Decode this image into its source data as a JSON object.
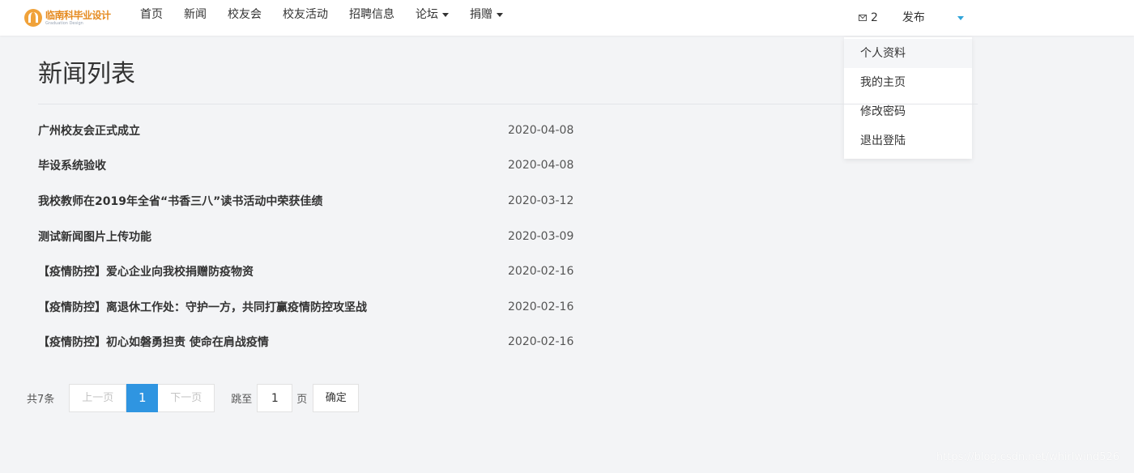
{
  "header": {
    "logo_text": "临南科毕业设计",
    "logo_sub": "Graduation Design",
    "nav": [
      {
        "label": "首页"
      },
      {
        "label": "新闻"
      },
      {
        "label": "校友会"
      },
      {
        "label": "校友活动"
      },
      {
        "label": "招聘信息"
      },
      {
        "label": "论坛"
      },
      {
        "label": "捐赠"
      }
    ],
    "mail_count": "2",
    "publish_label": "发布"
  },
  "user_menu": {
    "items": [
      {
        "label": "个人资料"
      },
      {
        "label": "我的主页"
      },
      {
        "label": "修改密码"
      },
      {
        "label": "退出登陆"
      }
    ]
  },
  "main": {
    "title": "新闻列表",
    "news": [
      {
        "title": "广州校友会正式成立",
        "date": "2020-04-08"
      },
      {
        "title": "毕设系统验收",
        "date": "2020-04-08"
      },
      {
        "title": "我校教师在2019年全省“书香三八”读书活动中荣获佳绩",
        "date": "2020-03-12"
      },
      {
        "title": "测试新闻图片上传功能",
        "date": "2020-03-09"
      },
      {
        "title": "【疫情防控】爱心企业向我校捐赠防疫物资",
        "date": "2020-02-16"
      },
      {
        "title": "【疫情防控】离退休工作处：守护一方，共同打赢疫情防控攻坚战",
        "date": "2020-02-16"
      },
      {
        "title": "【疫情防控】初心如磐勇担责 使命在肩战疫情",
        "date": "2020-02-16"
      }
    ]
  },
  "pagination": {
    "total": "共7条",
    "prev": "上一页",
    "current": "1",
    "next": "下一页",
    "jump_to": "跳至",
    "page_value": "1",
    "page_unit": "页",
    "confirm": "确定"
  },
  "watermark": "https://blog.csdn.net/whirlwind526",
  "colors": {
    "accent": "#2f95e1",
    "caret": "#2fa4d9",
    "logo": "#e58a1f"
  },
  "icons": {
    "mail": "mail-icon",
    "caret": "caret-down-icon"
  }
}
